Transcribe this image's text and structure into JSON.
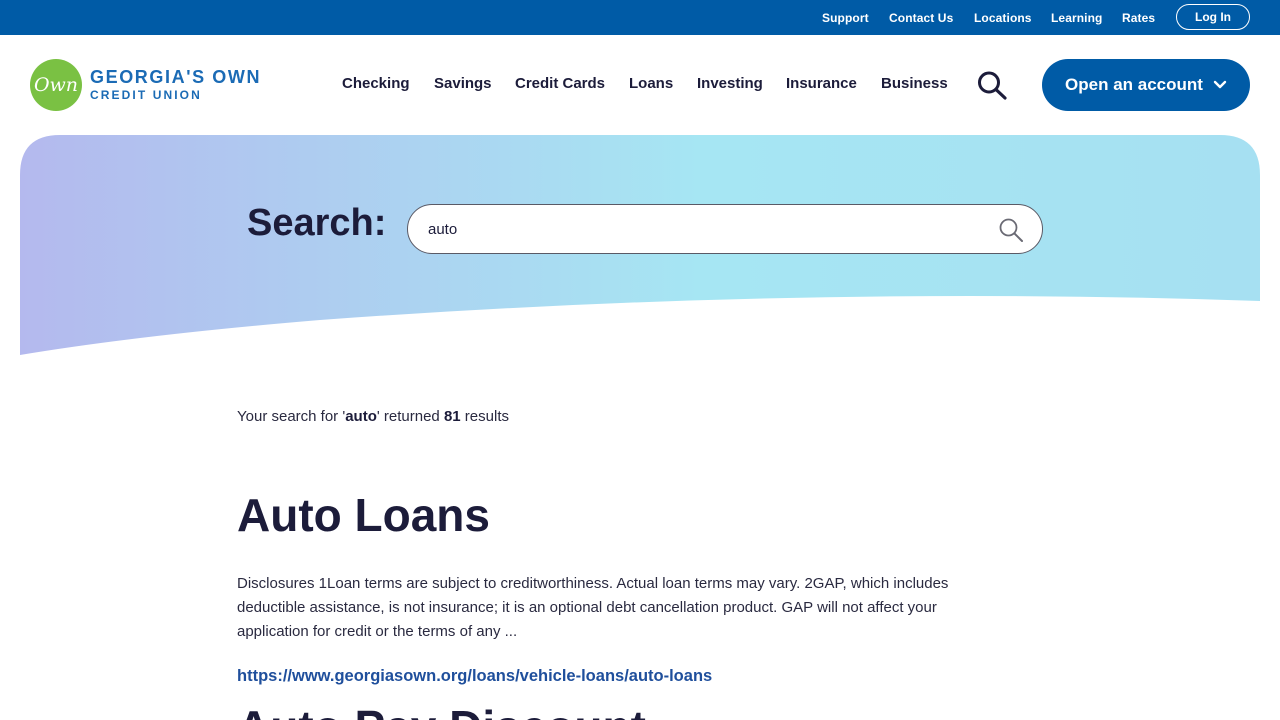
{
  "utility_nav": {
    "links": [
      "Support",
      "Contact Us",
      "Locations",
      "Learning",
      "Rates"
    ],
    "login_label": "Log In"
  },
  "logo": {
    "mark_text": "Own",
    "line1": "GEORGIA'S OWN",
    "line2": "CREDIT UNION"
  },
  "main_nav": {
    "items": [
      "Checking",
      "Savings",
      "Credit Cards",
      "Loans",
      "Investing",
      "Insurance",
      "Business"
    ],
    "open_account_label": "Open an account"
  },
  "search": {
    "label": "Search:",
    "value": "auto"
  },
  "results": {
    "summary": {
      "prefix": "Your search for '",
      "query": "auto",
      "middle": "' returned ",
      "count": "81",
      "suffix": " results"
    },
    "items": [
      {
        "title": "Auto Loans",
        "description": "Disclosures 1Loan terms are subject to creditworthiness. Actual loan terms may vary. 2GAP, which includes deductible assistance, is not insurance; it is an optional debt cancellation product. GAP will not affect your application for credit or the terms of any ...",
        "url": "https://www.georgiasown.org/loans/vehicle-loans/auto-loans"
      },
      {
        "title": "Auto Pay Discount"
      }
    ]
  },
  "colors": {
    "brand_blue": "#005ba6",
    "logo_green": "#7ac143",
    "hero_gradient_start": "#b4b9ee",
    "hero_gradient_end": "#a6e3f2"
  }
}
